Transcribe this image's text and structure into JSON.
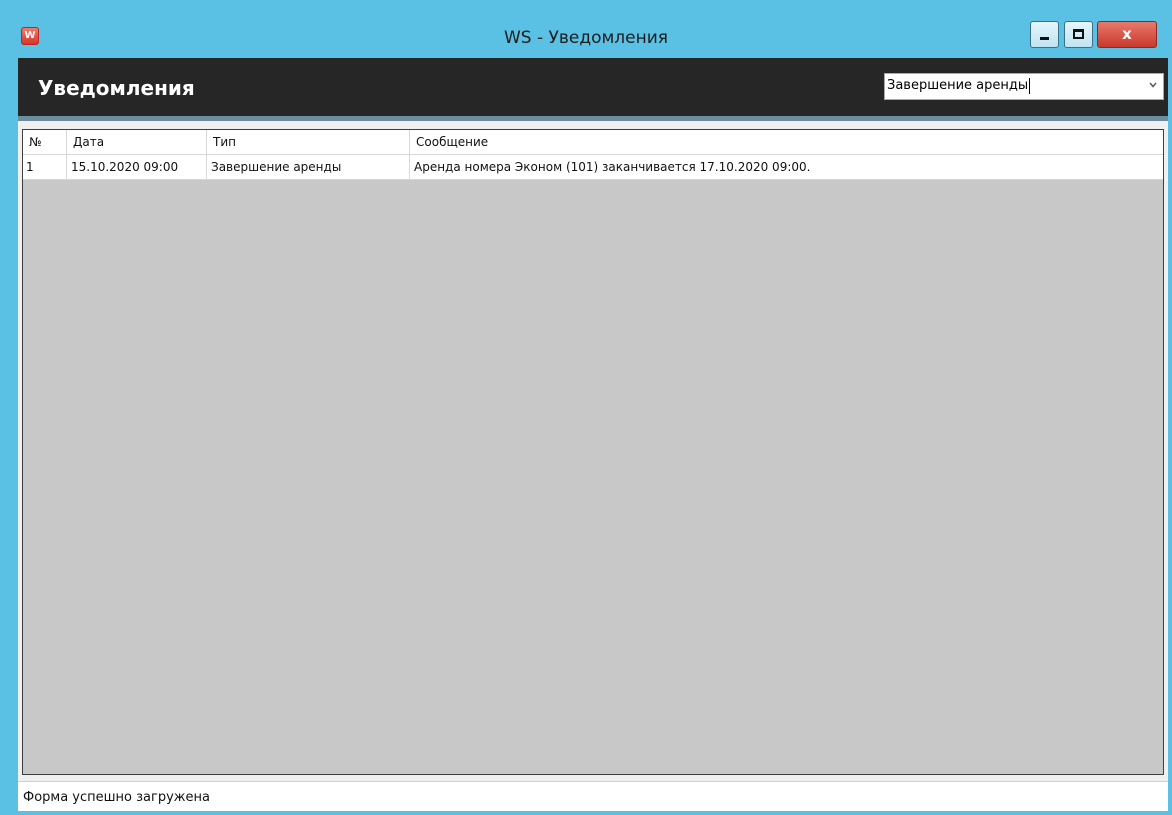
{
  "window": {
    "title": "WS - Уведомления",
    "app_icon_letter": "W",
    "controls": {
      "minimize": "minimize",
      "maximize": "maximize",
      "close_label": "x"
    },
    "colors": {
      "frame": "#5bc1e4",
      "header": "#262626",
      "close": "#c8392c",
      "grid_background": "#c8c8c8"
    }
  },
  "header": {
    "title": "Уведомления",
    "type_filter": {
      "selected": "Завершение аренды",
      "icon": "chevron-down-icon"
    }
  },
  "grid": {
    "columns": [
      "№",
      "Дата",
      "Тип",
      "Сообщение"
    ],
    "rows": [
      {
        "num": "1",
        "date": "15.10.2020 09:00",
        "type": "Завершение аренды",
        "message": "Аренда номера Эконом (101) заканчивается 17.10.2020 09:00."
      }
    ]
  },
  "statusbar": {
    "text": "Форма успешно загружена"
  }
}
